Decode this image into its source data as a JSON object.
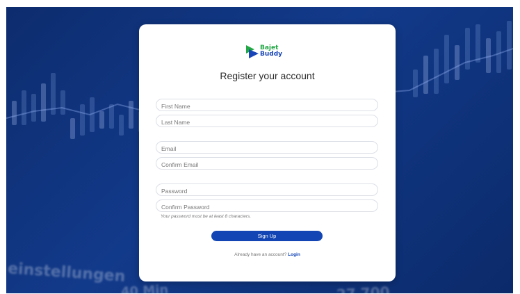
{
  "brand": {
    "logo_line1": "Bajet",
    "logo_line2": "Buddy",
    "colors": {
      "green": "#22a745",
      "blue": "#1845b8"
    }
  },
  "form": {
    "title": "Register your account",
    "first_name_placeholder": "First Name",
    "last_name_placeholder": "Last Name",
    "email_placeholder": "Email",
    "confirm_email_placeholder": "Confirm Email",
    "password_placeholder": "Password",
    "confirm_password_placeholder": "Confirm Password",
    "password_hint": "Your password must be at least 8 characters.",
    "submit_label": "Sign Up",
    "login_prompt": "Already have an account?",
    "login_link": "Login"
  },
  "background": {
    "text_1": "einstellungen",
    "text_2": "40 Min",
    "text_3": "27 700"
  },
  "colors": {
    "accent": "#1346b4",
    "background": "#123a8a",
    "card": "#ffffff"
  }
}
